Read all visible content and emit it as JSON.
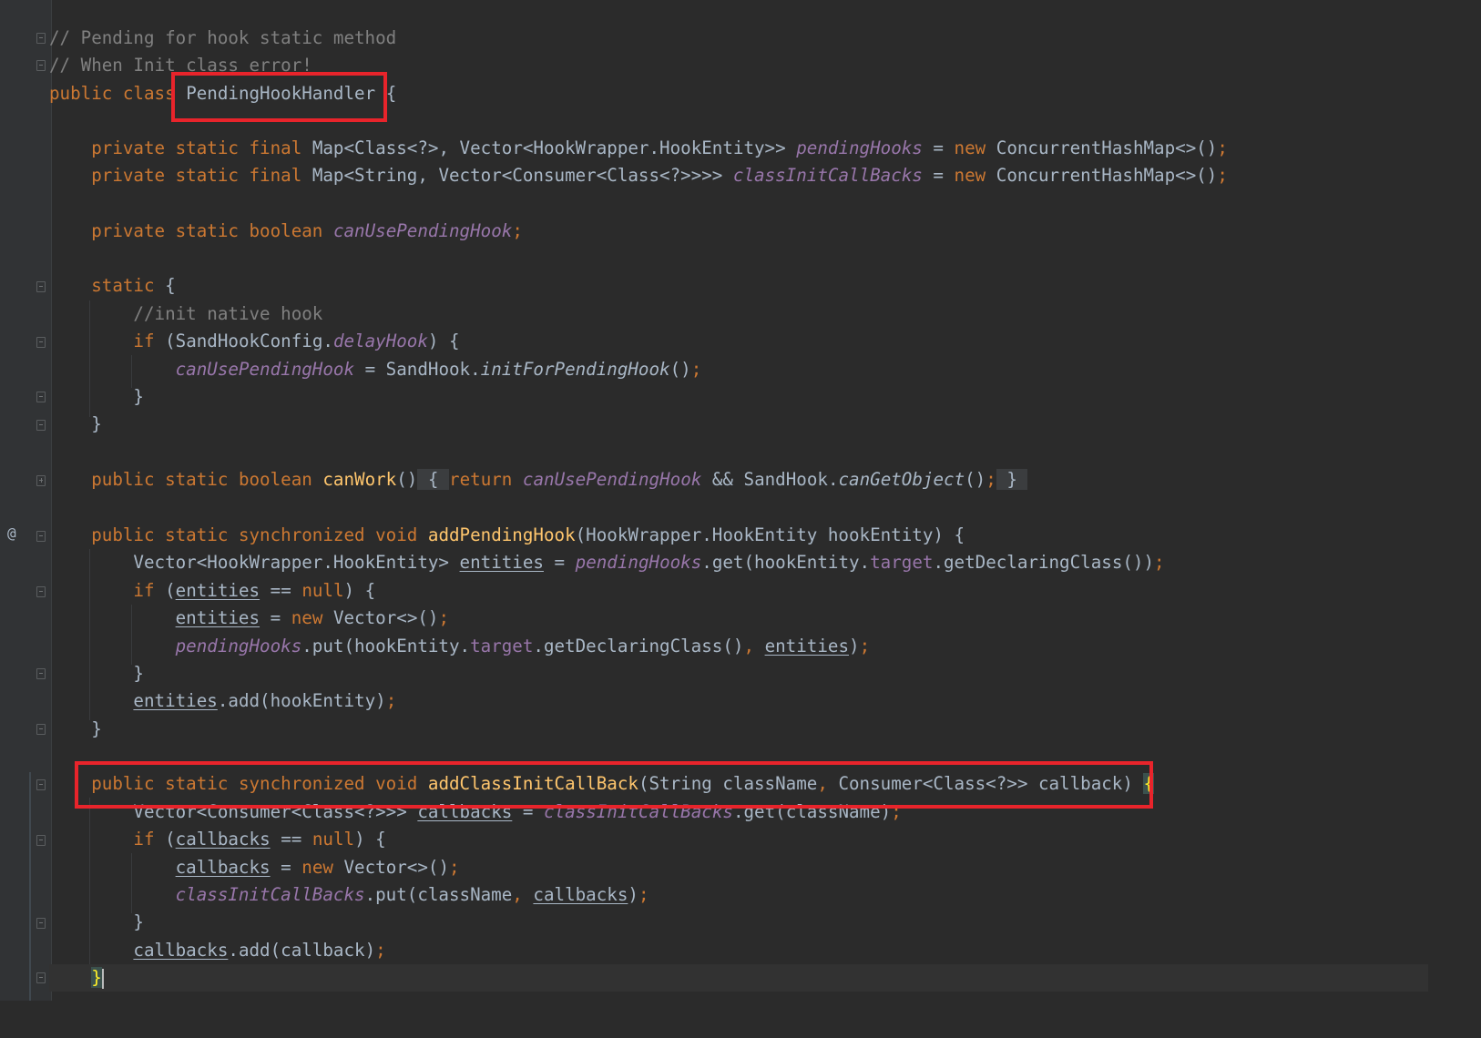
{
  "editor": {
    "class_name": "PendingHookHandler",
    "highlighted_method": "addClassInitCallBack",
    "gutter_icon": "override-at-icon",
    "lines": {
      "l01_comment": "// Pending for hook static method",
      "l02_comment": "// When Init class error!",
      "l03_kw": "public class",
      "l03_name": "PendingHookHandler",
      "l03_brace": "{",
      "l05_kw": "private static final",
      "l05_type": "Map<Class<?>, Vector<HookWrapper.HookEntity>>",
      "l05_field": "pendingHooks",
      "l05_eq": "=",
      "l05_new": "new",
      "l05_ctor": "ConcurrentHashMap<>()",
      "l05_semi": ";",
      "l06_kw": "private static final",
      "l06_type": "Map<String, Vector<Consumer<Class<?>>>>",
      "l06_field": "classInitCallBacks",
      "l06_eq": "=",
      "l06_new": "new",
      "l06_ctor": "ConcurrentHashMap<>()",
      "l06_semi": ";",
      "l08_kw": "private static boolean",
      "l08_field": "canUsePendingHook",
      "l08_semi": ";",
      "l10_kw": "static",
      "l10_brace": "{",
      "l11_comment": "//init native hook",
      "l12_kw": "if",
      "l12_open": "(SandHookConfig.",
      "l12_field": "delayHook",
      "l12_close": ") {",
      "l13_field": "canUsePendingHook",
      "l13_mid": "= SandHook.",
      "l13_call": "initForPendingHook",
      "l13_paren": "()",
      "l13_semi": ";",
      "l14_brace": "}",
      "l15_brace": "}",
      "l17_kw": "public static boolean",
      "l17_method": "canWork",
      "l17_paren": "()",
      "l17_fold_open": "{",
      "l17_ret": "return",
      "l17_field": "canUsePendingHook",
      "l17_mid": "&& SandHook.",
      "l17_call": "canGetObject",
      "l17_paren2": "()",
      "l17_semi": ";",
      "l17_fold_close": "}",
      "l19_kw": "public static synchronized void",
      "l19_method": "addPendingHook",
      "l19_params": "(HookWrapper.HookEntity hookEntity) {",
      "l20_type": "Vector<HookWrapper.HookEntity>",
      "l20_var": "entities",
      "l20_eq": "=",
      "l20_field": "pendingHooks",
      "l20_rest1": ".get(hookEntity.",
      "l20_target": "target",
      "l20_rest2": ".getDeclaringClass())",
      "l20_semi": ";",
      "l21_kw": "if",
      "l21_open": "(",
      "l21_var": "entities",
      "l21_eq": "==",
      "l21_null": "null",
      "l21_close": ") {",
      "l22_var": "entities",
      "l22_eq": "=",
      "l22_new": "new",
      "l22_ctor": "Vector<>()",
      "l22_semi": ";",
      "l23_field": "pendingHooks",
      "l23_rest1": ".put(hookEntity.",
      "l23_target": "target",
      "l23_rest2": ".getDeclaringClass()",
      "l23_comma": ",",
      "l23_var": "entities",
      "l23_close": ")",
      "l23_semi": ";",
      "l24_brace": "}",
      "l25_var": "entities",
      "l25_rest": ".add(hookEntity)",
      "l25_semi": ";",
      "l26_brace": "}",
      "l28_kw": "public static synchronized void",
      "l28_method": "addClassInitCallBack",
      "l28_p1": "(String className",
      "l28_comma": ",",
      "l28_p2": "Consumer<Class<?>> callback)",
      "l28_brace": "{",
      "l29_type": "Vector<Consumer<Class<?>>>",
      "l29_var": "callbacks",
      "l29_eq": "=",
      "l29_field": "classInitCallBacks",
      "l29_rest": ".get(className)",
      "l29_semi": ";",
      "l30_kw": "if",
      "l30_open": "(",
      "l30_var": "callbacks",
      "l30_eq": "==",
      "l30_null": "null",
      "l30_close": ") {",
      "l31_var": "callbacks",
      "l31_eq": "=",
      "l31_new": "new",
      "l31_ctor": "Vector<>()",
      "l31_semi": ";",
      "l32_field": "classInitCallBacks",
      "l32_rest": ".put(className",
      "l32_comma": ",",
      "l32_var": "callbacks",
      "l32_close": ")",
      "l32_semi": ";",
      "l33_brace": "}",
      "l34_var": "callbacks",
      "l34_rest": ".add(callback)",
      "l34_semi": ";",
      "l35_brace": "}"
    },
    "gutter_at": "@"
  }
}
